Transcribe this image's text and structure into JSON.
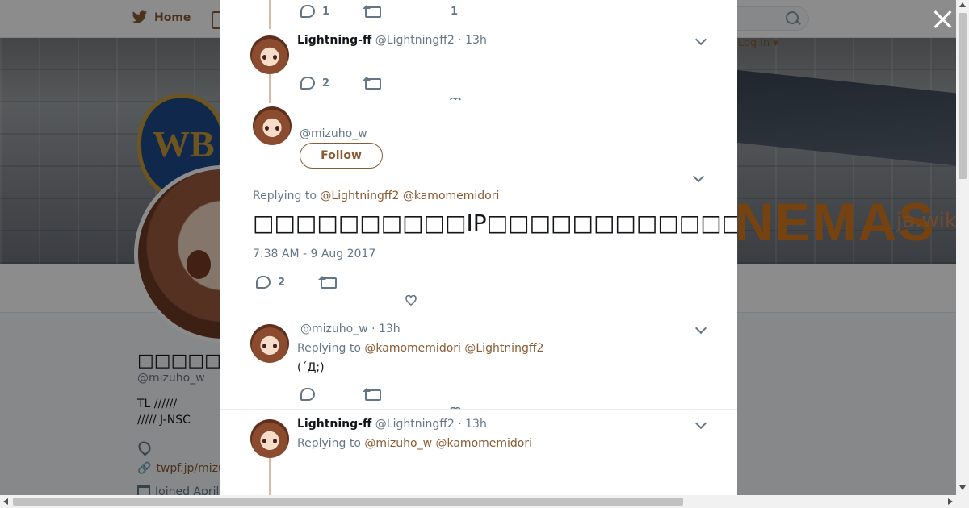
{
  "nav": {
    "home_label": "Home",
    "login_label": "Log in"
  },
  "profile": {
    "name": "□□□□□□□",
    "handle": "@mizuho_w",
    "bio_line1": "TL //////",
    "bio_line2": "/////   J-NSC",
    "link": "twpf.jp/mizu",
    "joined": "Joined April",
    "banner_text": "NEMAS",
    "banner_wiki": "ja.wik"
  },
  "thread": {
    "top_stats": {
      "replies": "1",
      "likes": "1"
    },
    "tweet1": {
      "name": "Lightning-ff",
      "handle": "@Lightningff2",
      "time": "· 13h",
      "replies": "2"
    },
    "main": {
      "handle": "@mizuho_w",
      "follow_label": "Follow",
      "replying_prefix": "Replying to",
      "replying_to": [
        "@Lightningff2",
        "@kamomemidori"
      ],
      "text": "□□□□□□□□□□IP□□□□□□□□□□□□□□□□□□□□□□□□□□□□□□□□□□□□□□□□□□□□□",
      "date": "7:38 AM - 9 Aug 2017",
      "replies": "2"
    },
    "tweet3": {
      "handle": "@mizuho_w",
      "time": "· 13h",
      "replying_prefix": "Replying to",
      "replying_to": [
        "@kamomemidori",
        "@Lightningff2"
      ],
      "text": "(´Д;)"
    },
    "tweet4": {
      "name": "Lightning-ff",
      "handle": "@Lightningff2",
      "time": "· 13h",
      "replying_prefix": "Replying to",
      "replying_to": [
        "@mizuho_w",
        "@kamomemidori"
      ]
    }
  },
  "colors": {
    "accent": "#8a5a32",
    "muted": "#657786",
    "text": "#14171a",
    "thread_line": "#d9b9a0"
  }
}
